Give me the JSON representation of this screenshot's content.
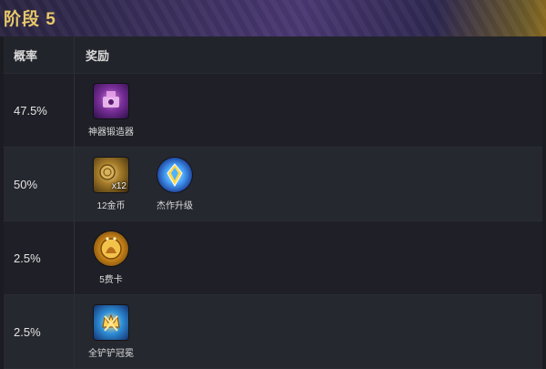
{
  "title": "阶段 5",
  "columns": {
    "probability": "概率",
    "reward": "奖励"
  },
  "rows": [
    {
      "probability": "47.5%",
      "items": [
        {
          "label": "神器锻造器",
          "icon": "artifact-anvil-icon"
        }
      ]
    },
    {
      "probability": "50%",
      "items": [
        {
          "label": "12金币",
          "icon": "gold-coins-icon",
          "qty": "x12"
        },
        {
          "label": "杰作升级",
          "icon": "masterwork-upgrade-icon"
        }
      ]
    },
    {
      "probability": "2.5%",
      "items": [
        {
          "label": "5费卡",
          "icon": "five-cost-card-icon"
        }
      ]
    },
    {
      "probability": "2.5%",
      "items": [
        {
          "label": "全铲铲冠冕",
          "icon": "spatula-crown-icon"
        }
      ]
    }
  ]
}
